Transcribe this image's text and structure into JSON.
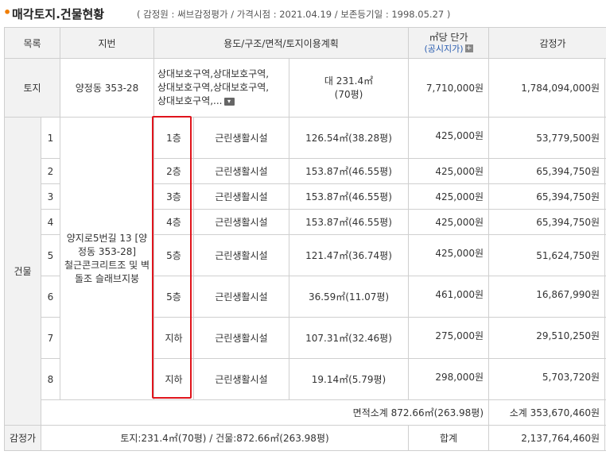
{
  "header": {
    "title": "매각토지.건물현황",
    "subtitle": "( 감정원 : 써브감정평가 / 가격시점 : 2021.04.19 / 보존등기일 : 1998.05.27 )"
  },
  "columns": {
    "item": "목록",
    "lot": "지번",
    "usage": "용도/구조/면적/토지이용계획",
    "unit_price": "㎡당 단가",
    "unit_price_link": "(공시지가)",
    "appraisal": "감정가"
  },
  "land": {
    "label": "토지",
    "lot": "양정동 353-28",
    "zoning": "상대보호구역,상대보호구역,\n상대보호구역,상대보호구역,\n상대보호구역,...",
    "area_line1": "대 231.4㎡",
    "area_line2": "(70평)",
    "unit_price": "7,710,000원",
    "appraisal": "1,784,094,000원"
  },
  "building": {
    "label": "건물",
    "address": "양지로5번길 13 [양정동 353-28]\n철근콘크리트조 및 벽돌조 슬래브지붕",
    "rows": [
      {
        "no": "1",
        "floor": "1층",
        "use": "근린생활시설",
        "area": "126.54㎡(38.28평)",
        "unit": "425,000원",
        "price": "53,779,500원"
      },
      {
        "no": "2",
        "floor": "2층",
        "use": "근린생활시설",
        "area": "153.87㎡(46.55평)",
        "unit": "425,000원",
        "price": "65,394,750원"
      },
      {
        "no": "3",
        "floor": "3층",
        "use": "근린생활시설",
        "area": "153.87㎡(46.55평)",
        "unit": "425,000원",
        "price": "65,394,750원"
      },
      {
        "no": "4",
        "floor": "4층",
        "use": "근린생활시설",
        "area": "153.87㎡(46.55평)",
        "unit": "425,000원",
        "price": "65,394,750원"
      },
      {
        "no": "5",
        "floor": "5층",
        "use": "근린생활시설",
        "area": "121.47㎡(36.74평)",
        "unit": "425,000원",
        "price": "51,624,750원"
      },
      {
        "no": "6",
        "floor": "5층",
        "use": "근린생활시설",
        "area": "36.59㎡(11.07평)",
        "unit": "461,000원",
        "price": "16,867,990원"
      },
      {
        "no": "7",
        "floor": "지하",
        "use": "근린생활시설",
        "area": "107.31㎡(32.46평)",
        "unit": "275,000원",
        "price": "29,510,250원"
      },
      {
        "no": "8",
        "floor": "지하",
        "use": "근린생활시설",
        "area": "19.14㎡(5.79평)",
        "unit": "298,000원",
        "price": "5,703,720원"
      }
    ],
    "area_subtotal": "면적소계 872.66㎡(263.98평)",
    "price_subtotal": "소계 353,670,460원"
  },
  "summary": {
    "label": "감정가",
    "detail": "토지:231.4㎡(70평) / 건물:872.66㎡(263.98평)",
    "total_label": "합계",
    "total": "2,137,764,460원"
  }
}
